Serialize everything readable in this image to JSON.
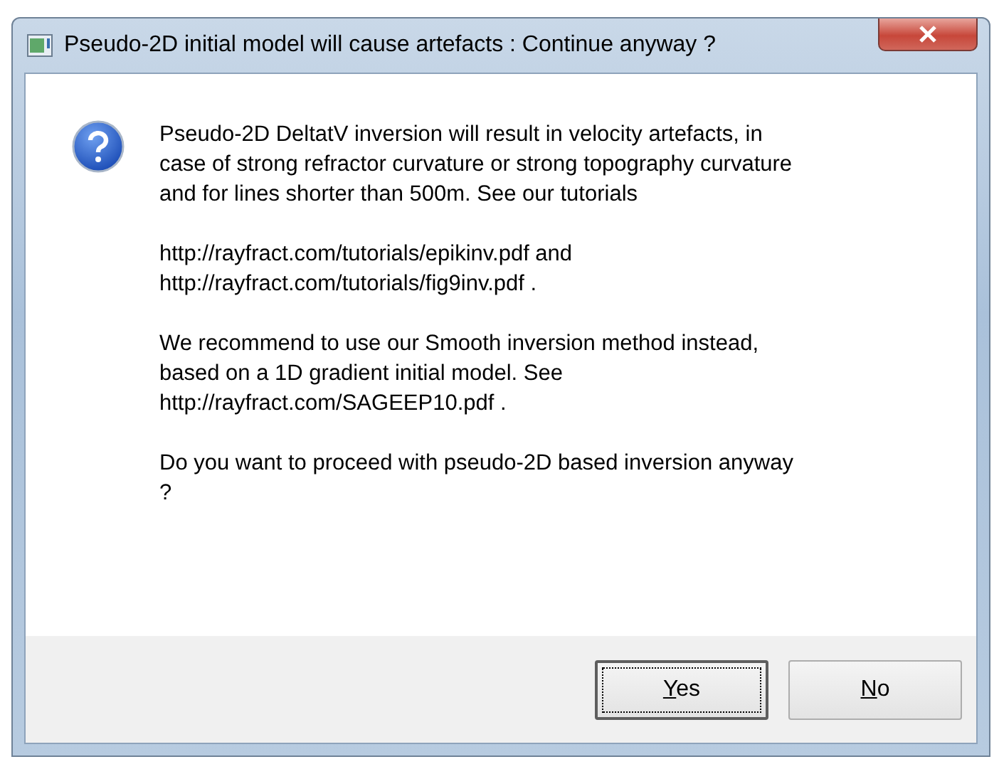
{
  "window": {
    "title": "Pseudo-2D initial model will cause artefacts : Continue anyway ?"
  },
  "message": {
    "paragraphs": [
      [
        "Pseudo-2D DeltatV inversion will result in velocity artefacts, in",
        "case of strong refractor curvature or strong topography curvature",
        "and for lines shorter than 500m. See our tutorials"
      ],
      [
        "http://rayfract.com/tutorials/epikinv.pdf and",
        "http://rayfract.com/tutorials/fig9inv.pdf ."
      ],
      [
        "We recommend to use our Smooth inversion method instead,",
        "based on a 1D gradient initial model. See",
        "http://rayfract.com/SAGEEP10.pdf ."
      ],
      [
        "Do you want to proceed with pseudo-2D based inversion anyway",
        "?"
      ]
    ]
  },
  "buttons": [
    {
      "label": "Yes",
      "focused": true
    },
    {
      "label": "No",
      "focused": false
    }
  ]
}
